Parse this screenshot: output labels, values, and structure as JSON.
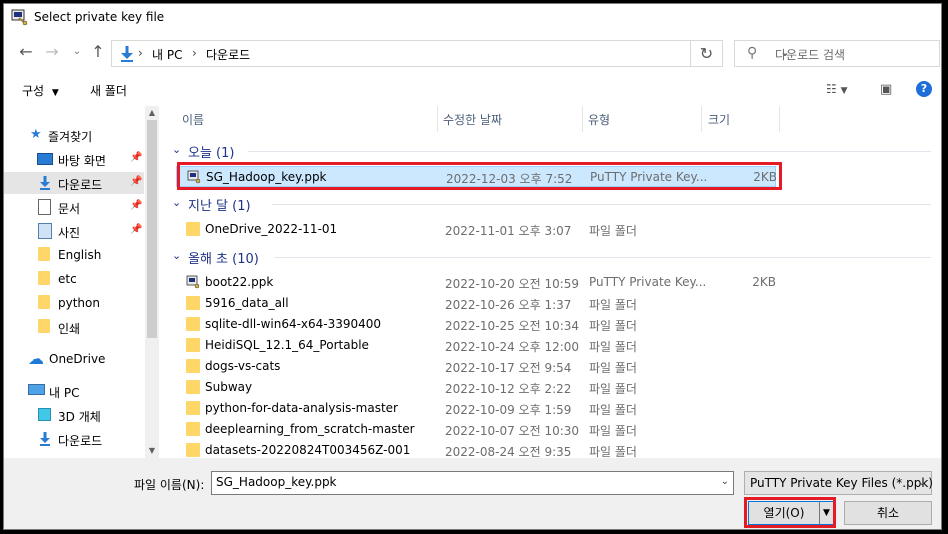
{
  "window": {
    "title": "Select private key file"
  },
  "nav": {
    "back_icon": "arrow-left-icon",
    "forward_icon": "arrow-right-icon",
    "up_icon": "arrow-up-icon",
    "breadcrumb": [
      "내 PC",
      "다운로드"
    ],
    "search_placeholder": "다운로드 검색"
  },
  "toolbar": {
    "organize_label": "구성",
    "new_folder_label": "새 폴더"
  },
  "sidebar": {
    "items": [
      {
        "label": "즐겨찾기",
        "icon": "star-icon",
        "pinned": false
      },
      {
        "label": "바탕 화면",
        "icon": "desktop-icon",
        "pinned": true
      },
      {
        "label": "다운로드",
        "icon": "download-icon",
        "pinned": true
      },
      {
        "label": "문서",
        "icon": "document-icon",
        "pinned": true
      },
      {
        "label": "사진",
        "icon": "picture-icon",
        "pinned": true
      },
      {
        "label": "English",
        "icon": "folder-icon",
        "pinned": false
      },
      {
        "label": "etc",
        "icon": "folder-icon",
        "pinned": false
      },
      {
        "label": "python",
        "icon": "folder-icon",
        "pinned": false
      },
      {
        "label": "인쇄",
        "icon": "folder-icon",
        "pinned": false
      },
      {
        "label": "OneDrive",
        "icon": "cloud-icon",
        "pinned": false
      },
      {
        "label": "내 PC",
        "icon": "computer-icon",
        "pinned": false
      },
      {
        "label": "3D 개체",
        "icon": "cube-icon",
        "pinned": false
      },
      {
        "label": "다운로드",
        "icon": "download-icon",
        "pinned": false
      }
    ]
  },
  "columns": {
    "name": "이름",
    "date": "수정한 날짜",
    "type": "유형",
    "size": "크기"
  },
  "groups": [
    {
      "label": "오늘 (1)"
    },
    {
      "label": "지난 달 (1)"
    },
    {
      "label": "올해 초 (10)"
    }
  ],
  "files": [
    {
      "name": "SG_Hadoop_key.ppk",
      "date": "2022-12-03 오후 7:52",
      "type": "PuTTY Private Key...",
      "size": "2KB",
      "icon": "putty-key-icon"
    },
    {
      "name": "OneDrive_2022-11-01",
      "date": "2022-11-01 오후 3:07",
      "type": "파일 폴더",
      "size": "",
      "icon": "folder-icon"
    },
    {
      "name": "boot22.ppk",
      "date": "2022-10-20 오전 10:59",
      "type": "PuTTY Private Key...",
      "size": "2KB",
      "icon": "putty-key-icon"
    },
    {
      "name": "5916_data_all",
      "date": "2022-10-26 오후 1:37",
      "type": "파일 폴더",
      "size": "",
      "icon": "folder-icon"
    },
    {
      "name": "sqlite-dll-win64-x64-3390400",
      "date": "2022-10-25 오전 10:34",
      "type": "파일 폴더",
      "size": "",
      "icon": "folder-icon"
    },
    {
      "name": "HeidiSQL_12.1_64_Portable",
      "date": "2022-10-24 오후 12:00",
      "type": "파일 폴더",
      "size": "",
      "icon": "folder-icon"
    },
    {
      "name": "dogs-vs-cats",
      "date": "2022-10-17 오전 9:54",
      "type": "파일 폴더",
      "size": "",
      "icon": "folder-icon"
    },
    {
      "name": "Subway",
      "date": "2022-10-12 오후 2:22",
      "type": "파일 폴더",
      "size": "",
      "icon": "folder-icon"
    },
    {
      "name": "python-for-data-analysis-master",
      "date": "2022-10-09 오후 1:59",
      "type": "파일 폴더",
      "size": "",
      "icon": "folder-icon"
    },
    {
      "name": "deeplearning_from_scratch-master",
      "date": "2022-10-07 오전 10:30",
      "type": "파일 폴더",
      "size": "",
      "icon": "folder-icon"
    },
    {
      "name": "datasets-20220824T003456Z-001",
      "date": "2022-08-24 오전 9:35",
      "type": "파일 폴더",
      "size": "",
      "icon": "folder-icon"
    }
  ],
  "bottom": {
    "filename_label": "파일 이름(N):",
    "filename_value": "SG_Hadoop_key.ppk",
    "filetype_value": "PuTTY Private Key Files (*.ppk)",
    "open_label": "열기(O)",
    "cancel_label": "취소"
  },
  "colors": {
    "highlight": "#e41b25",
    "selection": "#cce8ff",
    "group_text": "#1e3287"
  }
}
